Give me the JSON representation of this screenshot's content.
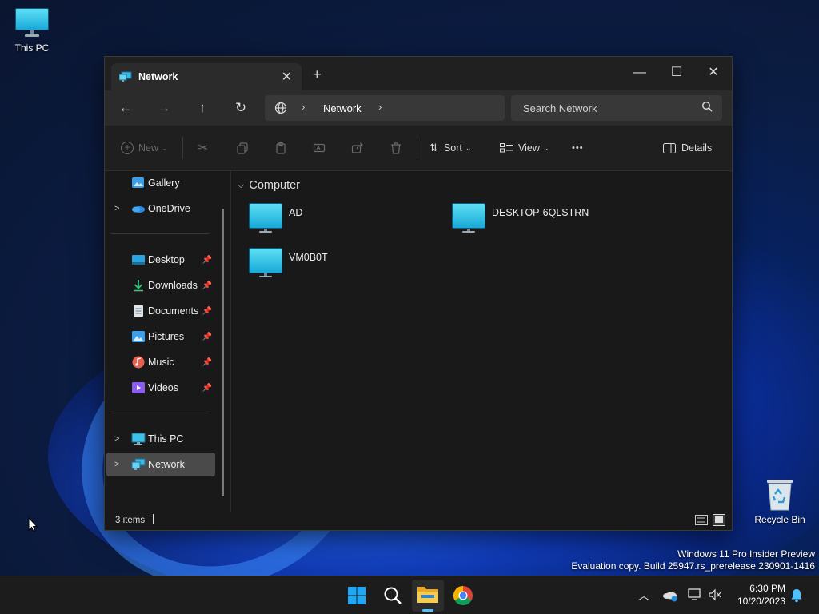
{
  "desktop": {
    "this_pc_label": "This PC",
    "recycle_bin_label": "Recycle Bin",
    "watermark_line1": "Windows 11 Pro Insider Preview",
    "watermark_line2": "Evaluation copy. Build 25947.rs_prerelease.230901-1416"
  },
  "window": {
    "tab_title": "Network",
    "tab_close_glyph": "✕",
    "new_tab_glyph": "+",
    "controls": {
      "minimize": "—",
      "maximize": "☐",
      "close": "✕"
    }
  },
  "navigation": {
    "back_glyph": "←",
    "forward_glyph": "→",
    "up_glyph": "↑",
    "refresh_glyph": "↻",
    "breadcrumb": [
      "Network"
    ],
    "search_placeholder": "Search Network"
  },
  "toolbar": {
    "new_label": "New",
    "sort_label": "Sort",
    "view_label": "View",
    "more_glyph": "•••",
    "details_label": "Details"
  },
  "sidebar": {
    "items": [
      {
        "label": "Gallery"
      },
      {
        "label": "OneDrive"
      },
      {
        "label": "Desktop"
      },
      {
        "label": "Downloads"
      },
      {
        "label": "Documents"
      },
      {
        "label": "Pictures"
      },
      {
        "label": "Music"
      },
      {
        "label": "Videos"
      },
      {
        "label": "This PC"
      },
      {
        "label": "Network"
      }
    ]
  },
  "content": {
    "group_title": "Computer",
    "items": [
      {
        "name": "AD"
      },
      {
        "name": "DESKTOP-6QLSTRN"
      },
      {
        "name": "VM0B0T"
      }
    ]
  },
  "status": {
    "item_count": "3 items"
  },
  "taskbar": {
    "time": "6:30 PM",
    "date": "10/20/2023"
  },
  "colors": {
    "accent": "#0078d4",
    "window_bg": "#191919",
    "selected": "#4a4a4a"
  }
}
